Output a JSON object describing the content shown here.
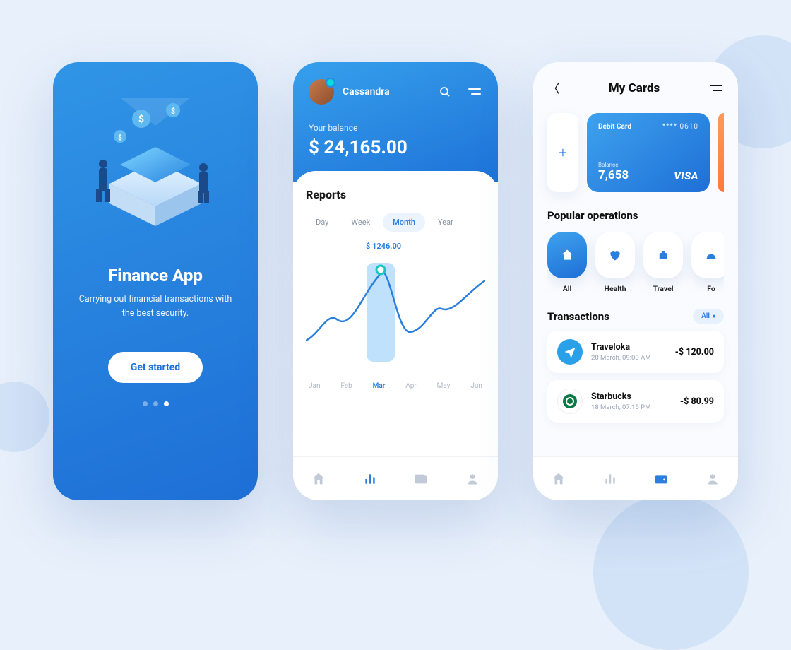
{
  "onboarding": {
    "title": "Finance App",
    "subtitle": "Carrying out financial transactions with the best security.",
    "cta": "Get started"
  },
  "dashboard": {
    "username": "Cassandra",
    "balance_label": "Your balance",
    "balance_value": "$ 24,165.00",
    "reports_title": "Reports",
    "periods": {
      "day": "Day",
      "week": "Week",
      "month": "Month",
      "year": "Year"
    },
    "tooltip": "$ 1246.00",
    "months": {
      "jan": "Jan",
      "feb": "Feb",
      "mar": "Mar",
      "apr": "Apr",
      "may": "May",
      "jun": "Jun"
    }
  },
  "cards": {
    "title": "My Cards",
    "card_type": "Debit Card",
    "card_mask": "**** 0610",
    "card_bal_label": "Balance",
    "card_balance": "7,658",
    "card_brand": "VISA",
    "ops_title": "Popular operations",
    "ops": {
      "all": "All",
      "health": "Health",
      "travel": "Travel",
      "food": "Fo"
    },
    "tx_title": "Transactions",
    "filter": "All",
    "tx1": {
      "name": "Traveloka",
      "time": "20 March, 09:00 AM",
      "amount": "-$ 120.00"
    },
    "tx2": {
      "name": "Starbucks",
      "time": "18 March, 07:15 PM",
      "amount": "-$ 80.99"
    }
  },
  "chart_data": {
    "type": "line",
    "categories": [
      "Jan",
      "Feb",
      "Mar",
      "Apr",
      "May",
      "Jun"
    ],
    "values": [
      520,
      780,
      1246,
      600,
      840,
      1100
    ],
    "highlight_index": 2,
    "highlight_value": 1246.0,
    "xlabel": "",
    "ylabel": "",
    "title": "Reports"
  }
}
